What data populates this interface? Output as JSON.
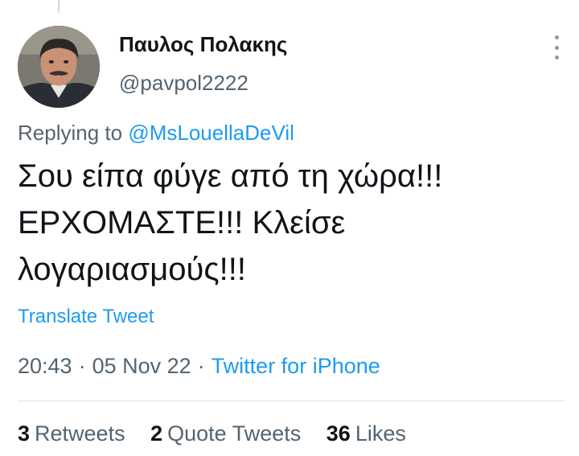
{
  "tweet": {
    "display_name": "Παυλος Πολακης",
    "handle": "@pavpol2222",
    "reply_prefix": "Replying to",
    "reply_to": "@MsLouellaDeVil",
    "text_lines": [
      "Σου είπα φύγε από τη χώρα!!!",
      "ΕΡΧΟΜΑΣΤΕ!!! Κλείσε",
      "λογαριασμούς!!!"
    ],
    "translate_label": "Translate Tweet",
    "time": "20:43",
    "date": "05 Nov 22",
    "separator": "·",
    "source": "Twitter for iPhone"
  },
  "stats": {
    "retweets_count": "3",
    "retweets_label": "Retweets",
    "quotes_count": "2",
    "quotes_label": "Quote Tweets",
    "likes_count": "36",
    "likes_label": "Likes"
  },
  "icons": {
    "more": "more-vertical-icon",
    "avatar": "profile-photo"
  },
  "colors": {
    "link_blue": "#1d9bf0",
    "secondary_text": "#536471",
    "primary_text": "#0f1419"
  }
}
